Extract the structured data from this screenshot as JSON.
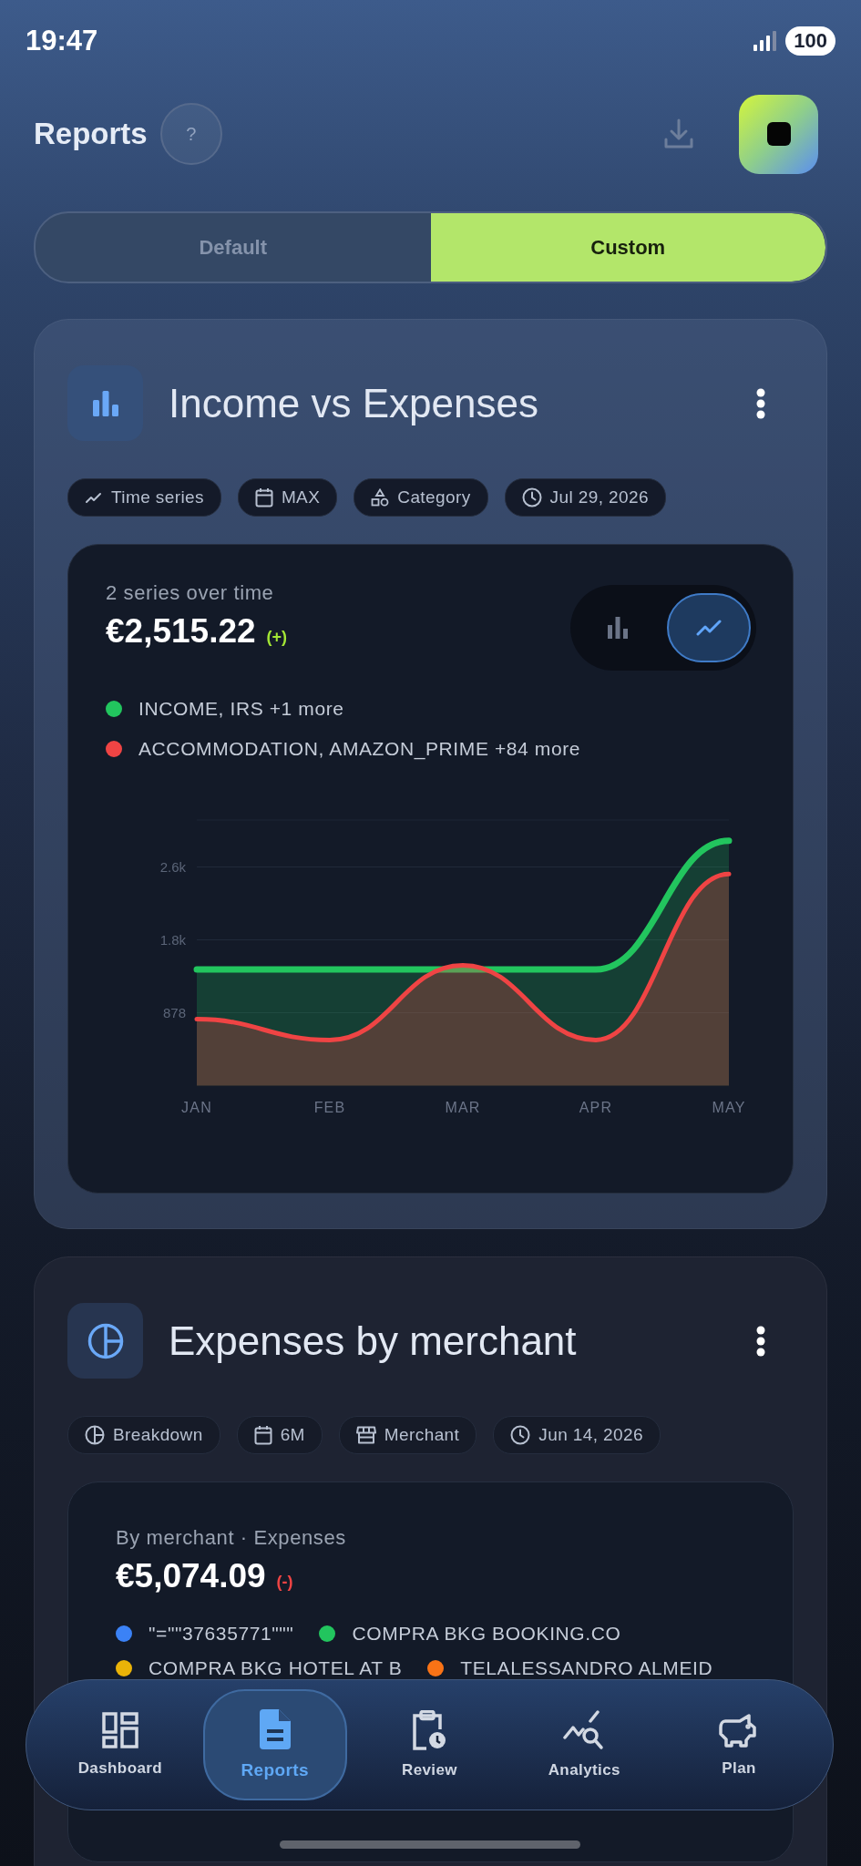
{
  "status_bar": {
    "time": "19:47",
    "battery": "100"
  },
  "header": {
    "title": "Reports",
    "help": "?"
  },
  "segments": [
    {
      "label": "Default",
      "selected": false
    },
    {
      "label": "Custom",
      "selected": true
    }
  ],
  "reports": [
    {
      "kind": "bar",
      "title": "Income vs Expenses",
      "chips": [
        {
          "kind": "trend",
          "label": "Time series"
        },
        {
          "kind": "calendar",
          "label": "MAX"
        },
        {
          "kind": "shapes",
          "label": "Category"
        },
        {
          "kind": "clock",
          "label": "Jul 29, 2026"
        }
      ],
      "panel": {
        "kind": "chart",
        "subtitle": "2 series over time",
        "amount": "€2,515.22",
        "change": {
          "text": "(+)",
          "kind": "gain"
        },
        "view_toggle": [
          {
            "kind": "bar",
            "selected": false
          },
          {
            "kind": "line",
            "selected": true
          }
        ],
        "chart_data": {
          "type": "area",
          "categories": [
            "JAN",
            "FEB",
            "MAR",
            "APR",
            "MAY"
          ],
          "series": [
            {
              "name": "INCOME, IRS +1 more",
              "color": "#22c55e",
              "values": [
                1400,
                1400,
                1400,
                1400,
                2950
              ]
            },
            {
              "name": "ACCOMMODATION, AMAZON_PRIME +84 more",
              "color": "#ef4444",
              "values": [
                800,
                550,
                1450,
                550,
                2550
              ]
            }
          ],
          "ylim": [
            0,
            3200
          ],
          "grid": true,
          "yticks": [
            {
              "value": 878,
              "label": "878"
            },
            {
              "value": 1756,
              "label": "1.8k"
            },
            {
              "value": 2634,
              "label": "2.6k"
            }
          ]
        }
      }
    },
    {
      "kind": "pie",
      "title": "Expenses by merchant",
      "chips": [
        {
          "kind": "pie",
          "label": "Breakdown"
        },
        {
          "kind": "calendar",
          "label": "6M"
        },
        {
          "kind": "store",
          "label": "Merchant"
        },
        {
          "kind": "clock",
          "label": "Jun 14, 2026"
        }
      ],
      "panel": {
        "kind": "breakdown",
        "subtitle": "By merchant · Expenses",
        "amount": "€5,074.09",
        "change": {
          "text": "(-)",
          "kind": "loss"
        },
        "legend": [
          {
            "label": "\"=\"\"37635771\"\"\"",
            "color": "#3b82f6"
          },
          {
            "label": "COMPRA BKG BOOKING.CO",
            "color": "#22c55e"
          },
          {
            "label": "COMPRA BKG HOTEL AT B",
            "color": "#eab308"
          },
          {
            "label": "TELALESSANDRO ALMEID",
            "color": "#f97316"
          }
        ]
      }
    }
  ],
  "nav": [
    {
      "kind": "dashboard",
      "label": "Dashboard",
      "selected": false
    },
    {
      "kind": "document",
      "label": "Reports",
      "selected": true
    },
    {
      "kind": "clipboard",
      "label": "Review",
      "selected": false
    },
    {
      "kind": "analytics",
      "label": "Analytics",
      "selected": false
    },
    {
      "kind": "piggy",
      "label": "Plan",
      "selected": false
    }
  ]
}
